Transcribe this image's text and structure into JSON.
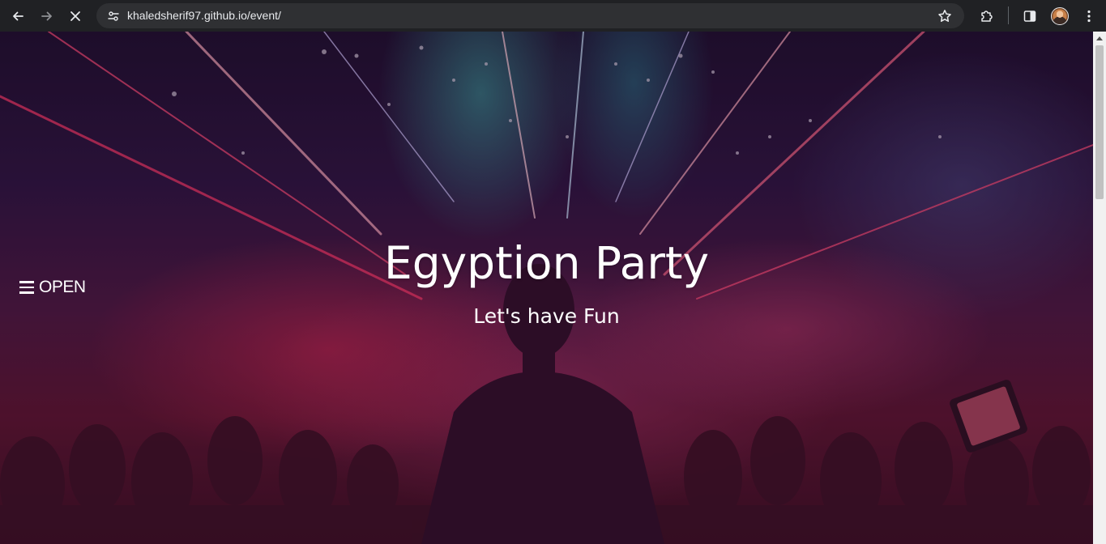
{
  "browser": {
    "url": "khaledsherif97.github.io/event/",
    "icons": {
      "back": "arrow-left-icon",
      "forward": "arrow-right-icon",
      "stop": "close-icon",
      "site_info": "tune-icon",
      "bookmark": "star-icon",
      "extensions": "puzzle-icon",
      "side_panel": "side-panel-icon",
      "profile": "avatar",
      "menu": "kebab-menu-icon"
    }
  },
  "page": {
    "menu_toggle_label": "OPEN",
    "hero_title": "Egyption Party",
    "hero_subtitle": "Let's have Fun"
  },
  "colors": {
    "chrome_bg": "#202124",
    "omnibox_bg": "#2f3033",
    "text_light": "#e8eaed",
    "hero_text": "#ffffff",
    "hero_accent_pink": "#d02a5a",
    "hero_accent_teal": "#3cbeb4"
  }
}
